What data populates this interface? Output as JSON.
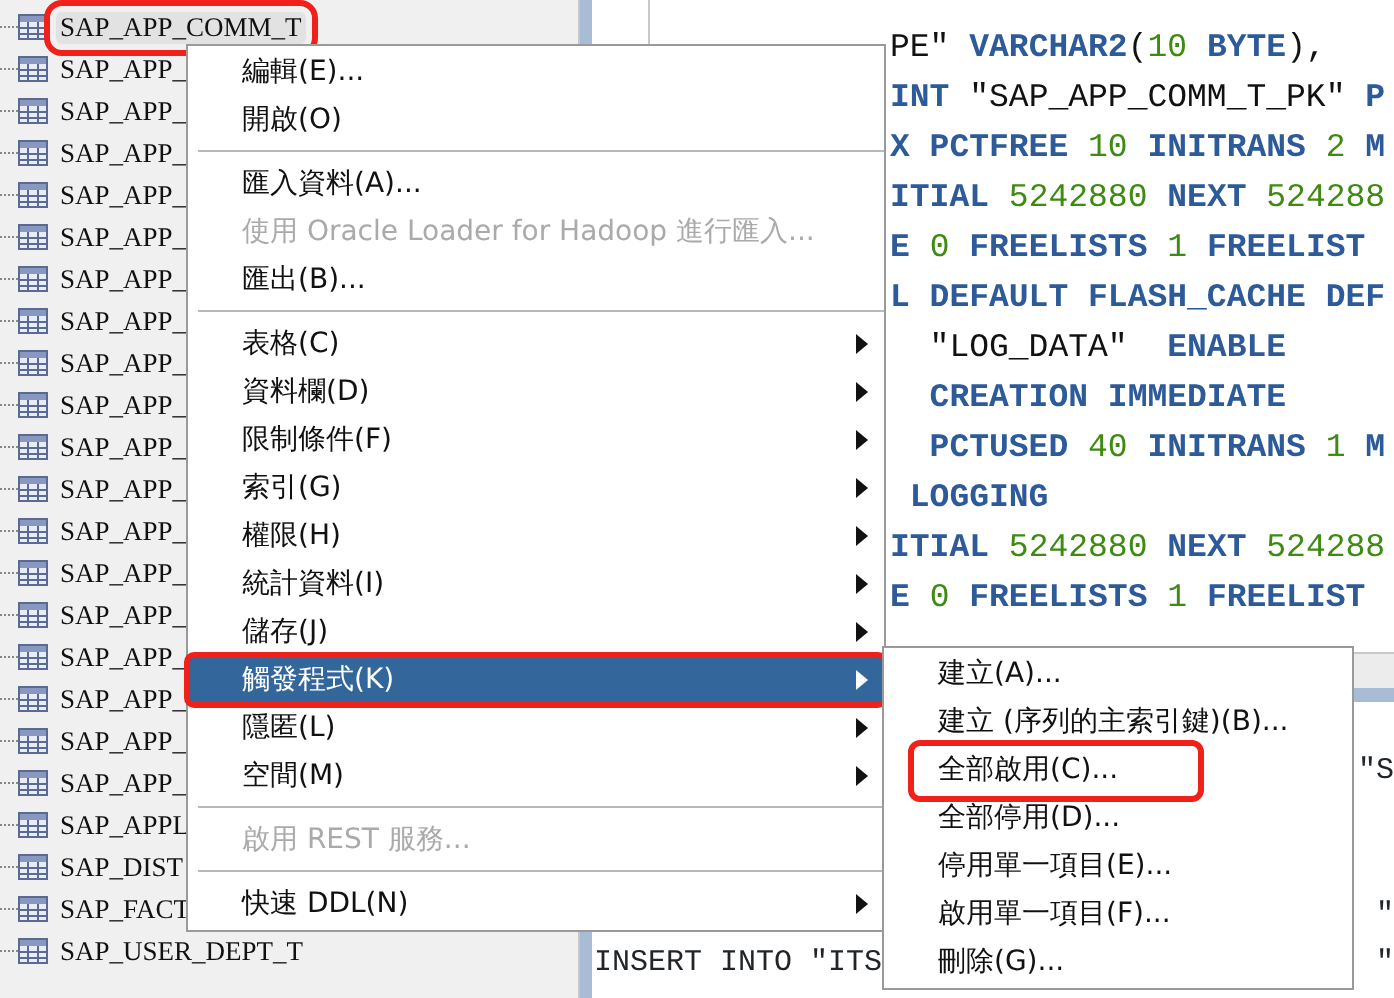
{
  "tree": {
    "rows": [
      {
        "label": "SAP_APP_COMM_T",
        "selected": true,
        "highlighted": true
      },
      {
        "label": "SAP_APP_",
        "selected": false,
        "highlighted": false
      },
      {
        "label": "SAP_APP_",
        "selected": false,
        "highlighted": false
      },
      {
        "label": "SAP_APP_",
        "selected": false,
        "highlighted": false
      },
      {
        "label": "SAP_APP_",
        "selected": false,
        "highlighted": false
      },
      {
        "label": "SAP_APP_",
        "selected": false,
        "highlighted": false
      },
      {
        "label": "SAP_APP_",
        "selected": false,
        "highlighted": false
      },
      {
        "label": "SAP_APP_",
        "selected": false,
        "highlighted": false
      },
      {
        "label": "SAP_APP_",
        "selected": false,
        "highlighted": false
      },
      {
        "label": "SAP_APP_",
        "selected": false,
        "highlighted": false
      },
      {
        "label": "SAP_APP_",
        "selected": false,
        "highlighted": false
      },
      {
        "label": "SAP_APP_",
        "selected": false,
        "highlighted": false
      },
      {
        "label": "SAP_APP_",
        "selected": false,
        "highlighted": false
      },
      {
        "label": "SAP_APP_",
        "selected": false,
        "highlighted": false
      },
      {
        "label": "SAP_APP_",
        "selected": false,
        "highlighted": false
      },
      {
        "label": "SAP_APP_",
        "selected": false,
        "highlighted": false
      },
      {
        "label": "SAP_APP_",
        "selected": false,
        "highlighted": false
      },
      {
        "label": "SAP_APP_",
        "selected": false,
        "highlighted": false
      },
      {
        "label": "SAP_APP_",
        "selected": false,
        "highlighted": false
      },
      {
        "label": "SAP_APPL",
        "selected": false,
        "highlighted": false
      },
      {
        "label": "SAP_DIST",
        "selected": false,
        "highlighted": false
      },
      {
        "label": "SAP_FACT",
        "selected": false,
        "highlighted": false
      },
      {
        "label": "SAP_USER_DEPT_T",
        "selected": false,
        "highlighted": false
      }
    ]
  },
  "editor": {
    "lines": [
      [
        {
          "kind": "plain",
          "text": "PE\" "
        },
        {
          "kind": "keyword",
          "text": "VARCHAR2"
        },
        {
          "kind": "plain",
          "text": "("
        },
        {
          "kind": "number",
          "text": "10"
        },
        {
          "kind": "keyword",
          "text": " BYTE"
        },
        {
          "kind": "plain",
          "text": "),"
        }
      ],
      [
        {
          "kind": "keyword",
          "text": "INT "
        },
        {
          "kind": "plain",
          "text": "\"SAP_APP_COMM_T_PK\" "
        },
        {
          "kind": "keyword",
          "text": "P"
        }
      ],
      [
        {
          "kind": "keyword",
          "text": "X PCTFREE "
        },
        {
          "kind": "number",
          "text": "10"
        },
        {
          "kind": "keyword",
          "text": " INITRANS "
        },
        {
          "kind": "number",
          "text": "2"
        },
        {
          "kind": "keyword",
          "text": " M"
        }
      ],
      [
        {
          "kind": "keyword",
          "text": "ITIAL "
        },
        {
          "kind": "number",
          "text": "5242880"
        },
        {
          "kind": "keyword",
          "text": " NEXT "
        },
        {
          "kind": "number",
          "text": "524288"
        }
      ],
      [
        {
          "kind": "keyword",
          "text": "E "
        },
        {
          "kind": "number",
          "text": "0"
        },
        {
          "kind": "keyword",
          "text": " FREELISTS "
        },
        {
          "kind": "number",
          "text": "1"
        },
        {
          "kind": "keyword",
          "text": " FREELIST"
        }
      ],
      [
        {
          "kind": "keyword",
          "text": "L DEFAULT FLASH_CACHE DEF"
        }
      ],
      [
        {
          "kind": "plain",
          "text": "  \"LOG_DATA\"  "
        },
        {
          "kind": "keyword",
          "text": "ENABLE"
        }
      ],
      [
        {
          "kind": "keyword",
          "text": "  CREATION IMMEDIATE"
        }
      ],
      [
        {
          "kind": "keyword",
          "text": "  PCTUSED "
        },
        {
          "kind": "number",
          "text": "40"
        },
        {
          "kind": "keyword",
          "text": " INITRANS "
        },
        {
          "kind": "number",
          "text": "1"
        },
        {
          "kind": "keyword",
          "text": " M"
        }
      ],
      [
        {
          "kind": "keyword",
          "text": " LOGGING"
        }
      ],
      [
        {
          "kind": "keyword",
          "text": "ITIAL "
        },
        {
          "kind": "number",
          "text": "5242880"
        },
        {
          "kind": "keyword",
          "text": " NEXT "
        },
        {
          "kind": "number",
          "text": "524288"
        }
      ],
      [
        {
          "kind": "keyword",
          "text": "E "
        },
        {
          "kind": "number",
          "text": "0"
        },
        {
          "kind": "keyword",
          "text": " FREELISTS "
        },
        {
          "kind": "number",
          "text": "1"
        },
        {
          "kind": "keyword",
          "text": " FREELIST"
        }
      ]
    ],
    "lower_lines": [
      {
        "right": "\"S"
      },
      {
        "right": "\""
      },
      {
        "left": "INSERT INTO \"ITS",
        "right": "\""
      }
    ]
  },
  "context_menu": {
    "items": [
      {
        "kind": "item",
        "label": "編輯(E)...",
        "disabled": false,
        "submenu": false,
        "selected": false,
        "highlighted": false
      },
      {
        "kind": "item",
        "label": "開啟(O)",
        "disabled": false,
        "submenu": false,
        "selected": false,
        "highlighted": false
      },
      {
        "kind": "separator"
      },
      {
        "kind": "item",
        "label": "匯入資料(A)...",
        "disabled": false,
        "submenu": false,
        "selected": false,
        "highlighted": false
      },
      {
        "kind": "item",
        "label": "使用 Oracle Loader for Hadoop 進行匯入...",
        "disabled": true,
        "submenu": false,
        "selected": false,
        "highlighted": false
      },
      {
        "kind": "item",
        "label": "匯出(B)...",
        "disabled": false,
        "submenu": false,
        "selected": false,
        "highlighted": false
      },
      {
        "kind": "separator"
      },
      {
        "kind": "item",
        "label": "表格(C)",
        "disabled": false,
        "submenu": true,
        "selected": false,
        "highlighted": false
      },
      {
        "kind": "item",
        "label": "資料欄(D)",
        "disabled": false,
        "submenu": true,
        "selected": false,
        "highlighted": false
      },
      {
        "kind": "item",
        "label": "限制條件(F)",
        "disabled": false,
        "submenu": true,
        "selected": false,
        "highlighted": false
      },
      {
        "kind": "item",
        "label": "索引(G)",
        "disabled": false,
        "submenu": true,
        "selected": false,
        "highlighted": false
      },
      {
        "kind": "item",
        "label": "權限(H)",
        "disabled": false,
        "submenu": true,
        "selected": false,
        "highlighted": false
      },
      {
        "kind": "item",
        "label": "統計資料(I)",
        "disabled": false,
        "submenu": true,
        "selected": false,
        "highlighted": false
      },
      {
        "kind": "item",
        "label": "儲存(J)",
        "disabled": false,
        "submenu": true,
        "selected": false,
        "highlighted": false
      },
      {
        "kind": "item",
        "label": "觸發程式(K)",
        "disabled": false,
        "submenu": true,
        "selected": true,
        "highlighted": true
      },
      {
        "kind": "item",
        "label": "隱匿(L)",
        "disabled": false,
        "submenu": true,
        "selected": false,
        "highlighted": false
      },
      {
        "kind": "item",
        "label": "空間(M)",
        "disabled": false,
        "submenu": true,
        "selected": false,
        "highlighted": false
      },
      {
        "kind": "separator"
      },
      {
        "kind": "item",
        "label": "啟用 REST 服務...",
        "disabled": true,
        "submenu": false,
        "selected": false,
        "highlighted": false
      },
      {
        "kind": "separator"
      },
      {
        "kind": "item",
        "label": "快速 DDL(N)",
        "disabled": false,
        "submenu": true,
        "selected": false,
        "highlighted": false
      }
    ]
  },
  "submenu": {
    "items": [
      {
        "kind": "item",
        "label": "建立(A)...",
        "disabled": false,
        "submenu": false,
        "selected": false,
        "highlighted": false
      },
      {
        "kind": "item",
        "label": "建立 (序列的主索引鍵)(B)...",
        "disabled": false,
        "submenu": false,
        "selected": false,
        "highlighted": false
      },
      {
        "kind": "item",
        "label": "全部啟用(C)...",
        "disabled": false,
        "submenu": false,
        "selected": false,
        "highlighted": true
      },
      {
        "kind": "item",
        "label": "全部停用(D)...",
        "disabled": false,
        "submenu": false,
        "selected": false,
        "highlighted": false
      },
      {
        "kind": "item",
        "label": "停用單一項目(E)...",
        "disabled": false,
        "submenu": false,
        "selected": false,
        "highlighted": false
      },
      {
        "kind": "item",
        "label": "啟用單一項目(F)...",
        "disabled": false,
        "submenu": false,
        "selected": false,
        "highlighted": false
      },
      {
        "kind": "item",
        "label": "刪除(G)...",
        "disabled": false,
        "submenu": false,
        "selected": false,
        "highlighted": false
      }
    ]
  }
}
